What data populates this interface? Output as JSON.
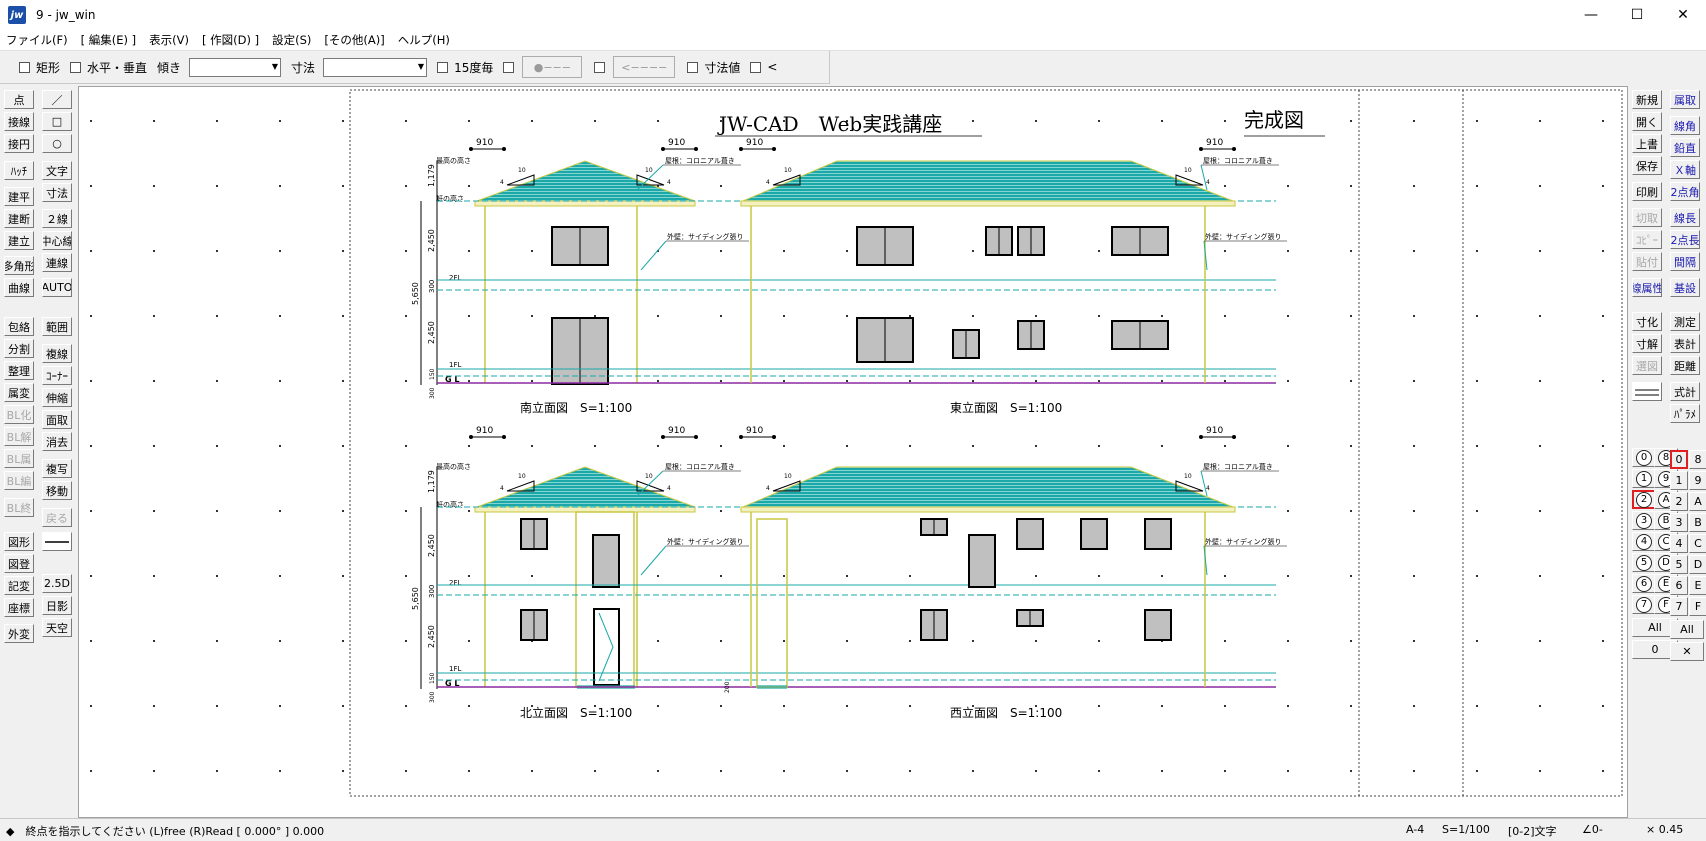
{
  "window": {
    "title": "9 - jw_win",
    "minimize": "—",
    "maximize": "☐",
    "close": "✕"
  },
  "menu": [
    "ファイル(F)",
    "[ 編集(E) ]",
    "表示(V)",
    "[ 作図(D) ]",
    "設定(S)",
    "[その他(A)]",
    "ヘルプ(H)"
  ],
  "toolbar": {
    "rect": "矩形",
    "hv": "水平・垂直",
    "tilt": "傾き",
    "dim": "寸法",
    "deg15": "15度毎",
    "btn1": "●−−−",
    "btn2": "<−−−−",
    "dimval": "寸法値",
    "lt": "<"
  },
  "left_tools": [
    "点",
    "接線",
    "接円",
    "ﾊｯﾁ",
    "建平",
    "建断",
    "建立",
    "多角形",
    "曲線",
    "包絡",
    "分割",
    "整理",
    "属変",
    "BL化",
    "BL解",
    "BL属",
    "BL編",
    "BL終",
    "図形",
    "図登",
    "記変",
    "座標",
    "外変",
    "／",
    "□",
    "○",
    "文字",
    "寸法",
    "２線",
    "中心線",
    "連線",
    "AUTO",
    "範囲",
    "複線",
    "ｺｰﾅｰ",
    "伸縮",
    "面取",
    "消去",
    "複写",
    "移動",
    "戻る",
    "2.5D",
    "日影",
    "天空"
  ],
  "right_tools": [
    "新規",
    "開く",
    "上書",
    "保存",
    "印刷",
    "切取",
    "ｺﾋﾟｰ",
    "貼付",
    "線属性",
    "寸化",
    "寸解",
    "選図",
    "属取",
    "線角",
    "鉛直",
    "Ｘ軸",
    "2点角",
    "線長",
    "2点長",
    "間隔",
    "基設",
    "測定",
    "表計",
    "距離",
    "式計",
    "ﾊﾟﾗﾒ"
  ],
  "layers": {
    "group_labels": [
      "0",
      "1",
      "2",
      "3",
      "4",
      "5",
      "6",
      "7",
      "8",
      "9",
      "A",
      "B",
      "C",
      "D",
      "E",
      "F"
    ],
    "layer_labels": [
      "0",
      "1",
      "2",
      "3",
      "4",
      "5",
      "6",
      "7",
      "8",
      "9",
      "A",
      "B",
      "C",
      "D",
      "E",
      "F"
    ],
    "all_left": "All",
    "zero_left": "0",
    "all_right": "All",
    "x_right": "✕"
  },
  "drawing": {
    "title": "JW-CAD　Web実践講座",
    "subtitle": "完成図",
    "view_south": "南立面図　S=1:100",
    "view_east": "東立面図　S=1:100",
    "view_north": "北立面図　S=1:100",
    "view_west": "西立面図　S=1:100",
    "dim_910": "910",
    "dim_10": "10",
    "dim_4": "4",
    "note_roof": "屋根：コロニアル葺き",
    "note_wall": "外壁：サイディング張り",
    "label_ridge": "最高の高さ",
    "label_eave": "軒の高さ",
    "label_2fl": "2FL",
    "label_1fl": "1FL",
    "label_gl": "G L",
    "dim_1179": "1,179",
    "dim_2450": "2,450",
    "dim_300": "300",
    "dim_5650": "5,650",
    "dim_150": "150",
    "dim_200": "200"
  },
  "status": {
    "prompt": "◆　終点を指示してください (L)free (R)Read [ 0.000° ] 0.000",
    "paper": "A-4",
    "scale": "S=1/100",
    "layer": "[0-2]文字",
    "angle": "∠0-",
    "zoom": "× 0.45"
  },
  "colors": {
    "roof": "#1aa8a8",
    "wall_outline": "#c8c840",
    "guide_line": "#1aa8a8",
    "ground_line": "#8a2aa0",
    "window_fill": "#c0c0c0"
  }
}
